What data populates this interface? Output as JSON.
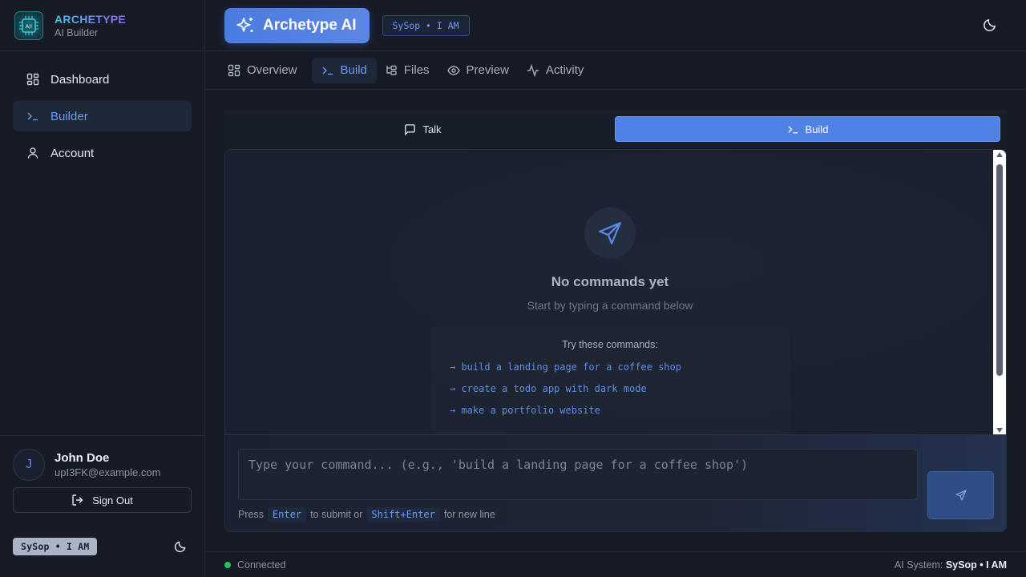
{
  "brand": {
    "name": "ARCHETYPE",
    "subtitle": "AI Builder"
  },
  "sidebar": {
    "items": [
      {
        "label": "Dashboard",
        "icon": "grid-icon",
        "active": false
      },
      {
        "label": "Builder",
        "icon": "terminal-icon",
        "active": true
      },
      {
        "label": "Account",
        "icon": "user-icon",
        "active": false
      }
    ]
  },
  "user": {
    "initial": "J",
    "name": "John Doe",
    "email": "upI3FK@example.com",
    "signout_label": "Sign Out"
  },
  "sidebar_footer": {
    "badge": "SySop • I AM"
  },
  "header": {
    "app_title": "Archetype AI",
    "badge": "SySop • I AM"
  },
  "tabs": [
    {
      "label": "Overview",
      "icon": "grid-icon",
      "active": false
    },
    {
      "label": "Build",
      "icon": "terminal-icon",
      "active": true
    },
    {
      "label": "Files",
      "icon": "folder-tree-icon",
      "active": false
    },
    {
      "label": "Preview",
      "icon": "eye-icon",
      "active": false
    },
    {
      "label": "Activity",
      "icon": "activity-icon",
      "active": false
    }
  ],
  "modes": {
    "talk_label": "Talk",
    "build_label": "Build",
    "active": "Build"
  },
  "empty_state": {
    "title": "No commands yet",
    "subtitle": "Start by typing a command below",
    "suggestions_title": "Try these commands:",
    "suggestions": [
      "→ build a landing page for a coffee shop",
      "→ create a todo app with dark mode",
      "→ make a portfolio website"
    ]
  },
  "input": {
    "placeholder": "Type your command... (e.g., 'build a landing page for a coffee shop')",
    "value": "",
    "hint_press": "Press",
    "hint_key1": "Enter",
    "hint_mid": "to submit or",
    "hint_key2": "Shift+Enter",
    "hint_end": "for new line"
  },
  "status": {
    "connection": "Connected",
    "system_label": "AI System:",
    "system_value": "SySop • I AM"
  },
  "colors": {
    "accent": "#4f82e4",
    "accent_text": "#6c9bf2",
    "background": "#151a25",
    "connected": "#23c25e"
  }
}
